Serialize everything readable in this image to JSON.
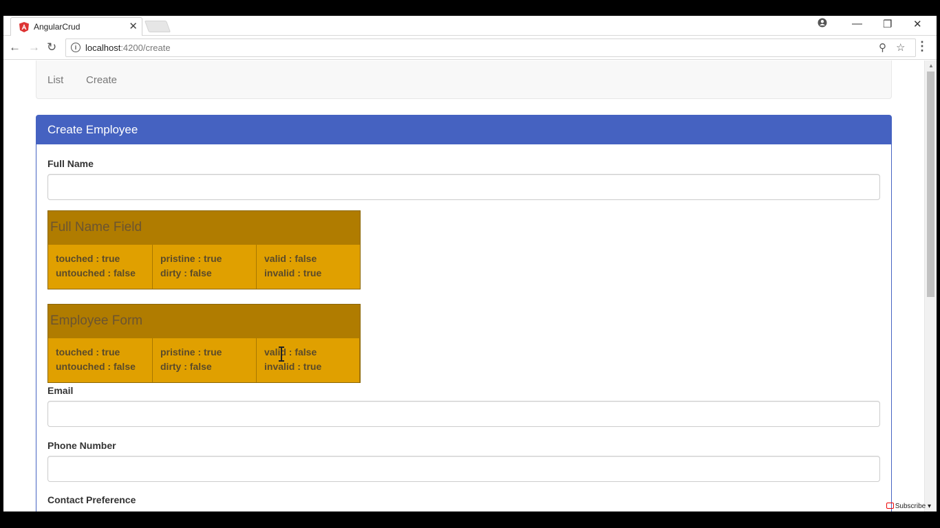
{
  "browser": {
    "tab_title": "AngularCrud",
    "url_host": "localhost",
    "url_path": ":4200/create",
    "colors": {
      "tab_favicon": "#dd3333"
    }
  },
  "nav": {
    "items": [
      {
        "label": "List"
      },
      {
        "label": "Create"
      }
    ]
  },
  "panel": {
    "title": "Create Employee",
    "accent_color": "#4562c1"
  },
  "form": {
    "full_name": {
      "label": "Full Name",
      "value": ""
    },
    "email": {
      "label": "Email",
      "value": ""
    },
    "phone": {
      "label": "Phone Number",
      "value": ""
    },
    "contact_preference": {
      "label": "Contact Preference"
    }
  },
  "status_boxes": [
    {
      "title": "Full Name Field",
      "columns": [
        [
          "touched : true",
          "untouched : false"
        ],
        [
          "pristine : true",
          "dirty : false"
        ],
        [
          "valid : false",
          "invalid : true"
        ]
      ]
    },
    {
      "title": "Employee Form",
      "columns": [
        [
          "touched : true",
          "untouched : false"
        ],
        [
          "pristine : true",
          "dirty : false"
        ],
        [
          "valid : false",
          "invalid : true"
        ]
      ]
    }
  ],
  "overlay": {
    "subscribe_label": "Subscribe"
  },
  "icons": [
    "angular-icon",
    "close-icon",
    "back-icon",
    "forward-icon",
    "reload-icon",
    "info-icon",
    "zoom-icon",
    "star-icon",
    "menu-icon",
    "profile-icon",
    "minimize-icon",
    "restore-icon",
    "window-close-icon"
  ]
}
